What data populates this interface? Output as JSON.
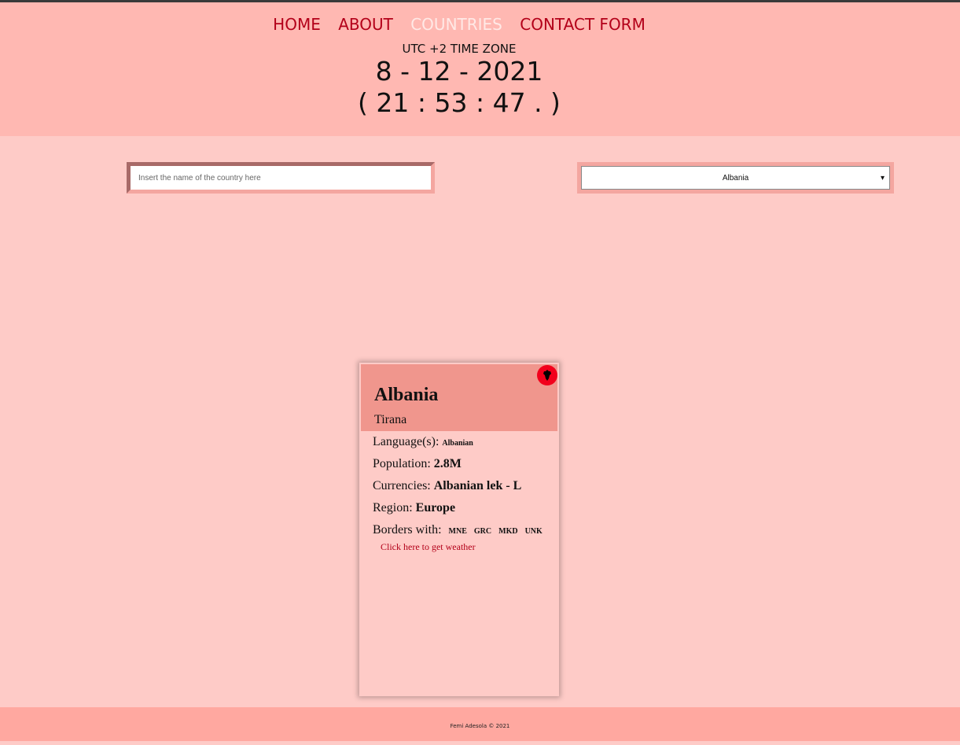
{
  "nav": {
    "items": [
      {
        "label": "HOME"
      },
      {
        "label": "ABOUT"
      },
      {
        "label": "COUNTRIES"
      },
      {
        "label": "CONTACT FORM"
      }
    ],
    "active": "COUNTRIES"
  },
  "clock": {
    "timezone": "UTC +2 TIME ZONE",
    "date": "8 - 12 - 2021",
    "time": "( 21 : 53 : 47 . )"
  },
  "search": {
    "placeholder": "Insert the name of the country here",
    "value": ""
  },
  "country_select": {
    "selected": "Albania"
  },
  "card": {
    "flag_icon": "albania-flag-icon",
    "name": "Albania",
    "capital": "Tirana",
    "languages_label": "Language(s):",
    "languages_value": "Albanian",
    "population_label": "Population:",
    "population_value": "2.8M",
    "currencies_label": "Currencies:",
    "currencies_value": "Albanian lek - L",
    "region_label": "Region:",
    "region_value": "Europe",
    "borders_label": "Borders with:",
    "borders": [
      "MNE",
      "GRC",
      "MKD",
      "UNK"
    ],
    "weather_link": "Click here to get weather"
  },
  "footer": {
    "text": "Femi Adesola © 2021"
  },
  "colors": {
    "header_bg": "#ffb8b2",
    "page_bg": "#fecbc7",
    "nav_link": "#b30019",
    "nav_active": "#ffe9e6",
    "card_header": "#f0968d",
    "footer_bg": "#ffa8a0"
  }
}
